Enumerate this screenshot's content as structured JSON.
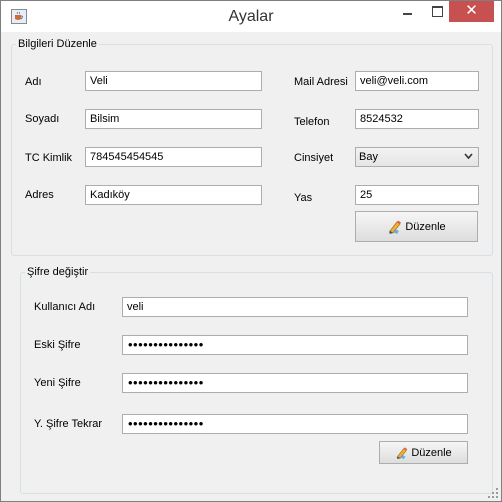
{
  "window": {
    "title": "Ayalar",
    "close_glyph": "✕",
    "app_icon": "java-cup-icon"
  },
  "profile": {
    "legend": "Bilgileri Düzenle",
    "name_label": "Adı",
    "name_value": "Veli",
    "surname_label": "Soyadı",
    "surname_value": "Bilsim",
    "tc_label": "TC Kimlik",
    "tc_value": "784545454545",
    "address_label": "Adres",
    "address_value": "Kadıköy",
    "mail_label": "Mail Adresi",
    "mail_value": "veli@veli.com",
    "phone_label": "Telefon",
    "phone_value": "8524532",
    "gender_label": "Cinsiyet",
    "gender_value": "Bay",
    "age_label": "Yas",
    "age_value": "25",
    "edit_button": "Düzenle",
    "edit_icon": "pencil-eraser-icon"
  },
  "password": {
    "legend": "Şifre değiştir",
    "username_label": "Kullanıcı Adı",
    "username_value": "veli",
    "old_label": "Eski Şifre",
    "old_value": "•••••••••••••••",
    "new_label": "Yeni Şifre",
    "new_value": "•••••••••••••••",
    "repeat_label": "Y. Şifre Tekrar",
    "repeat_value": "•••••••••••••••",
    "edit_button": "Düzenle",
    "edit_icon": "pencil-eraser-icon"
  }
}
